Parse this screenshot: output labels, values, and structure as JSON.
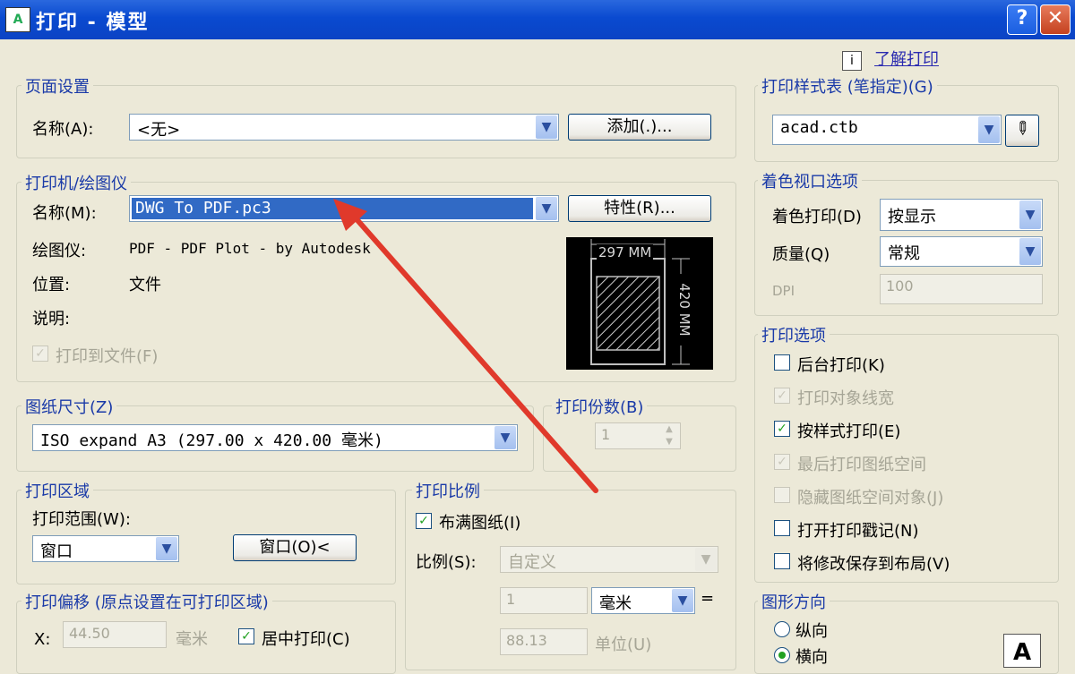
{
  "window": {
    "title": "打印 - 模型",
    "help": "?",
    "close": "✕"
  },
  "learn": {
    "icon": "i",
    "link": "了解打印"
  },
  "page_setup": {
    "title": "页面设置",
    "name_label": "名称(A):",
    "name_value": "<无>",
    "add_button": "添加(.)..."
  },
  "plotter": {
    "title": "打印机/绘图仪",
    "name_label": "名称(M):",
    "name_value": "DWG To PDF.pc3",
    "properties_button": "特性(R)...",
    "plotter_label": "绘图仪:",
    "plotter_value": "PDF - PDF Plot - by Autodesk",
    "location_label": "位置:",
    "location_value": "文件",
    "desc_label": "说明:",
    "print_to_file": "打印到文件(F)",
    "preview_width": "297 MM",
    "preview_height": "420 MM"
  },
  "paper_size": {
    "title": "图纸尺寸(Z)",
    "value": "ISO expand A3 (297.00 x 420.00 毫米)"
  },
  "copies": {
    "title": "打印份数(B)",
    "value": "1"
  },
  "plot_area": {
    "title": "打印区域",
    "range_label": "打印范围(W):",
    "range_value": "窗口",
    "window_button": "窗口(O)<"
  },
  "plot_scale": {
    "title": "打印比例",
    "fit_paper": "布满图纸(I)",
    "scale_label": "比例(S):",
    "scale_value": "自定义",
    "value1": "1",
    "unit": "毫米",
    "equals": "=",
    "value2": "88.13",
    "unit_label": "单位(U)"
  },
  "plot_offset": {
    "title": "打印偏移 (原点设置在可打印区域)",
    "x_label": "X:",
    "x_value": "44.50",
    "x_unit": "毫米",
    "center": "居中打印(C)"
  },
  "style_table": {
    "title": "打印样式表 (笔指定)(G)",
    "value": "acad.ctb"
  },
  "shaded_viewport": {
    "title": "着色视口选项",
    "shade_label": "着色打印(D)",
    "shade_value": "按显示",
    "quality_label": "质量(Q)",
    "quality_value": "常规",
    "dpi_label": "DPI",
    "dpi_value": "100"
  },
  "plot_options": {
    "title": "打印选项",
    "items": [
      {
        "label": "后台打印(K)",
        "checked": false,
        "enabled": true
      },
      {
        "label": "打印对象线宽",
        "checked": true,
        "enabled": false
      },
      {
        "label": "按样式打印(E)",
        "checked": true,
        "enabled": true
      },
      {
        "label": "最后打印图纸空间",
        "checked": true,
        "enabled": false
      },
      {
        "label": "隐藏图纸空间对象(J)",
        "checked": false,
        "enabled": false
      },
      {
        "label": "打开打印戳记(N)",
        "checked": false,
        "enabled": true
      },
      {
        "label": "将修改保存到布局(V)",
        "checked": false,
        "enabled": true
      }
    ]
  },
  "orientation": {
    "title": "图形方向",
    "portrait": "纵向",
    "landscape": "横向",
    "icon_letter": "A"
  },
  "colors": {
    "titlebar": "#0a4ad0",
    "group_title": "#1a3aa8",
    "selection": "#316ac5",
    "annotation_arrow": "#e0392b"
  }
}
